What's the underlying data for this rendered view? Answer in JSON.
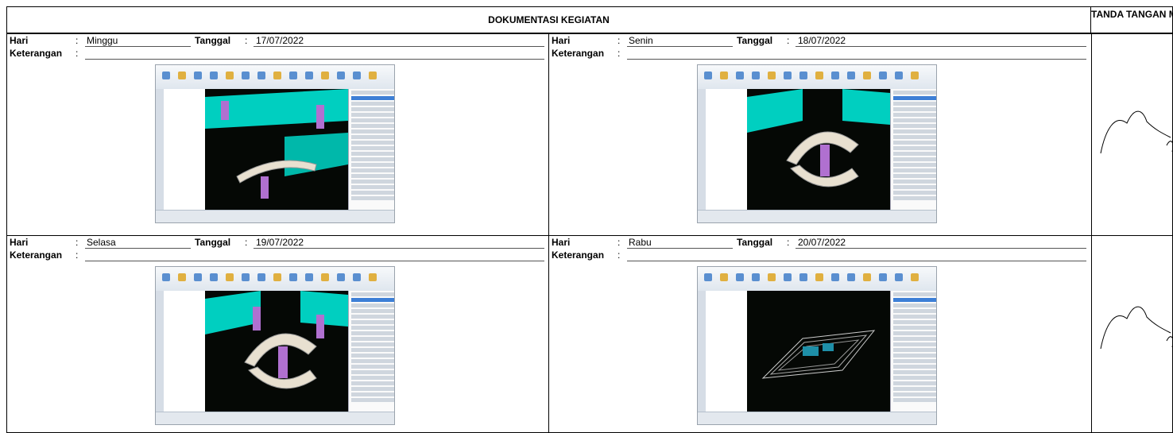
{
  "header": {
    "title": "DOKUMENTASI KEGIATAN",
    "mentor_col": "TANDA TANGAN MENTOR"
  },
  "labels": {
    "hari": "Hari",
    "tanggal": "Tanggal",
    "keterangan": "Keterangan",
    "colon": ":"
  },
  "entries": [
    {
      "day": "Minggu",
      "date": "17/07/2022",
      "note": "",
      "screenshot": "3d-structural-model-curved-slab"
    },
    {
      "day": "Senin",
      "date": "18/07/2022",
      "note": "",
      "screenshot": "3d-structural-model-c-shaped-slab"
    },
    {
      "day": "Selasa",
      "date": "19/07/2022",
      "note": "",
      "screenshot": "3d-structural-model-c-shaped-slab-columns"
    },
    {
      "day": "Rabu",
      "date": "20/07/2022",
      "note": "",
      "screenshot": "3d-structural-model-full-building"
    }
  ],
  "colors": {
    "border": "#000000",
    "slab": "#00e0d0",
    "column": "#b070d0",
    "viewport_bg": "#050805"
  }
}
